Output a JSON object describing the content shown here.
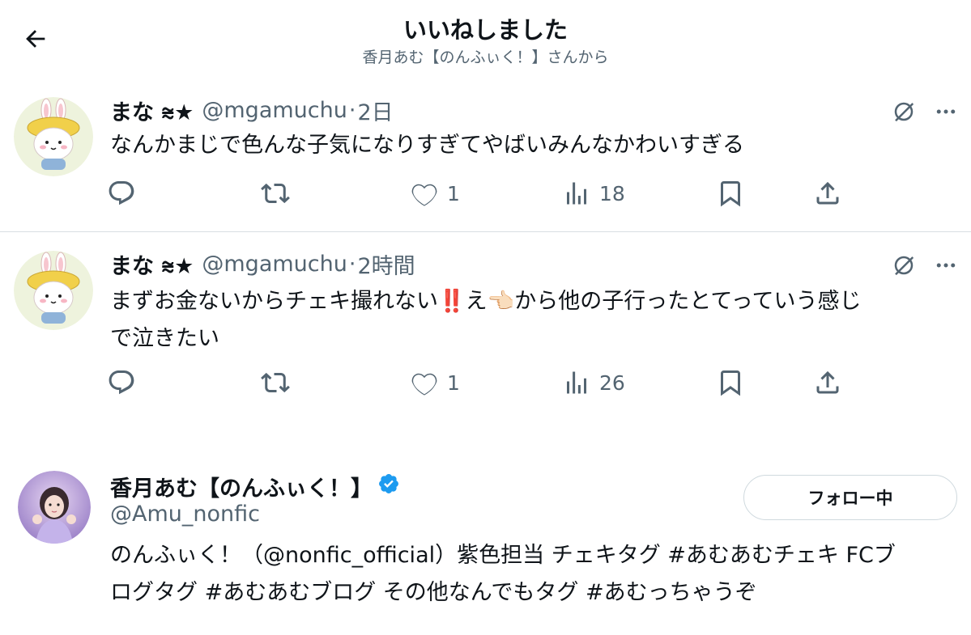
{
  "header": {
    "title": "いいねしました",
    "subtitle": "香月あむ【のんふぃく！】さんから"
  },
  "tweets": [
    {
      "name": "まな ⩬★",
      "handle": "@mgamuchu",
      "time": "2日",
      "text": "なんかまじで色んな子気になりすぎてやばいみんなかわいすぎる",
      "likes": "1",
      "views": "18"
    },
    {
      "name": "まな ⩬★",
      "handle": "@mgamuchu",
      "time": "2時間",
      "text_line1": "まずお金ないからチェキ撮れない‼️え👈🏻から他の子行ったとてっていう感じ",
      "text_line2": "で泣きたい",
      "likes": "1",
      "views": "26"
    }
  ],
  "profile": {
    "name": "香月あむ【のんふぃく！】",
    "handle": "@Amu_nonfic",
    "follow_label": "フォロー中",
    "bio_line1": "のんふぃく！（@nonfic_official）紫色担当 チェキタグ #あむあむチェキ FCブ",
    "bio_line2": "ログタグ #あむあむブログ その他なんでもタグ #あむっちゃうぞ"
  },
  "icons": {
    "back": "arrow-left-icon",
    "grok": "grok-icon",
    "more": "more-icon",
    "reply": "reply-icon",
    "retweet": "retweet-icon",
    "like": "heart-icon",
    "views": "views-icon",
    "bookmark": "bookmark-icon",
    "share": "share-icon",
    "verified": "verified-badge-icon"
  },
  "colors": {
    "text": "#0f1419",
    "secondary": "#536471",
    "divider": "#d8dee2",
    "verified": "#1d9bf0"
  }
}
